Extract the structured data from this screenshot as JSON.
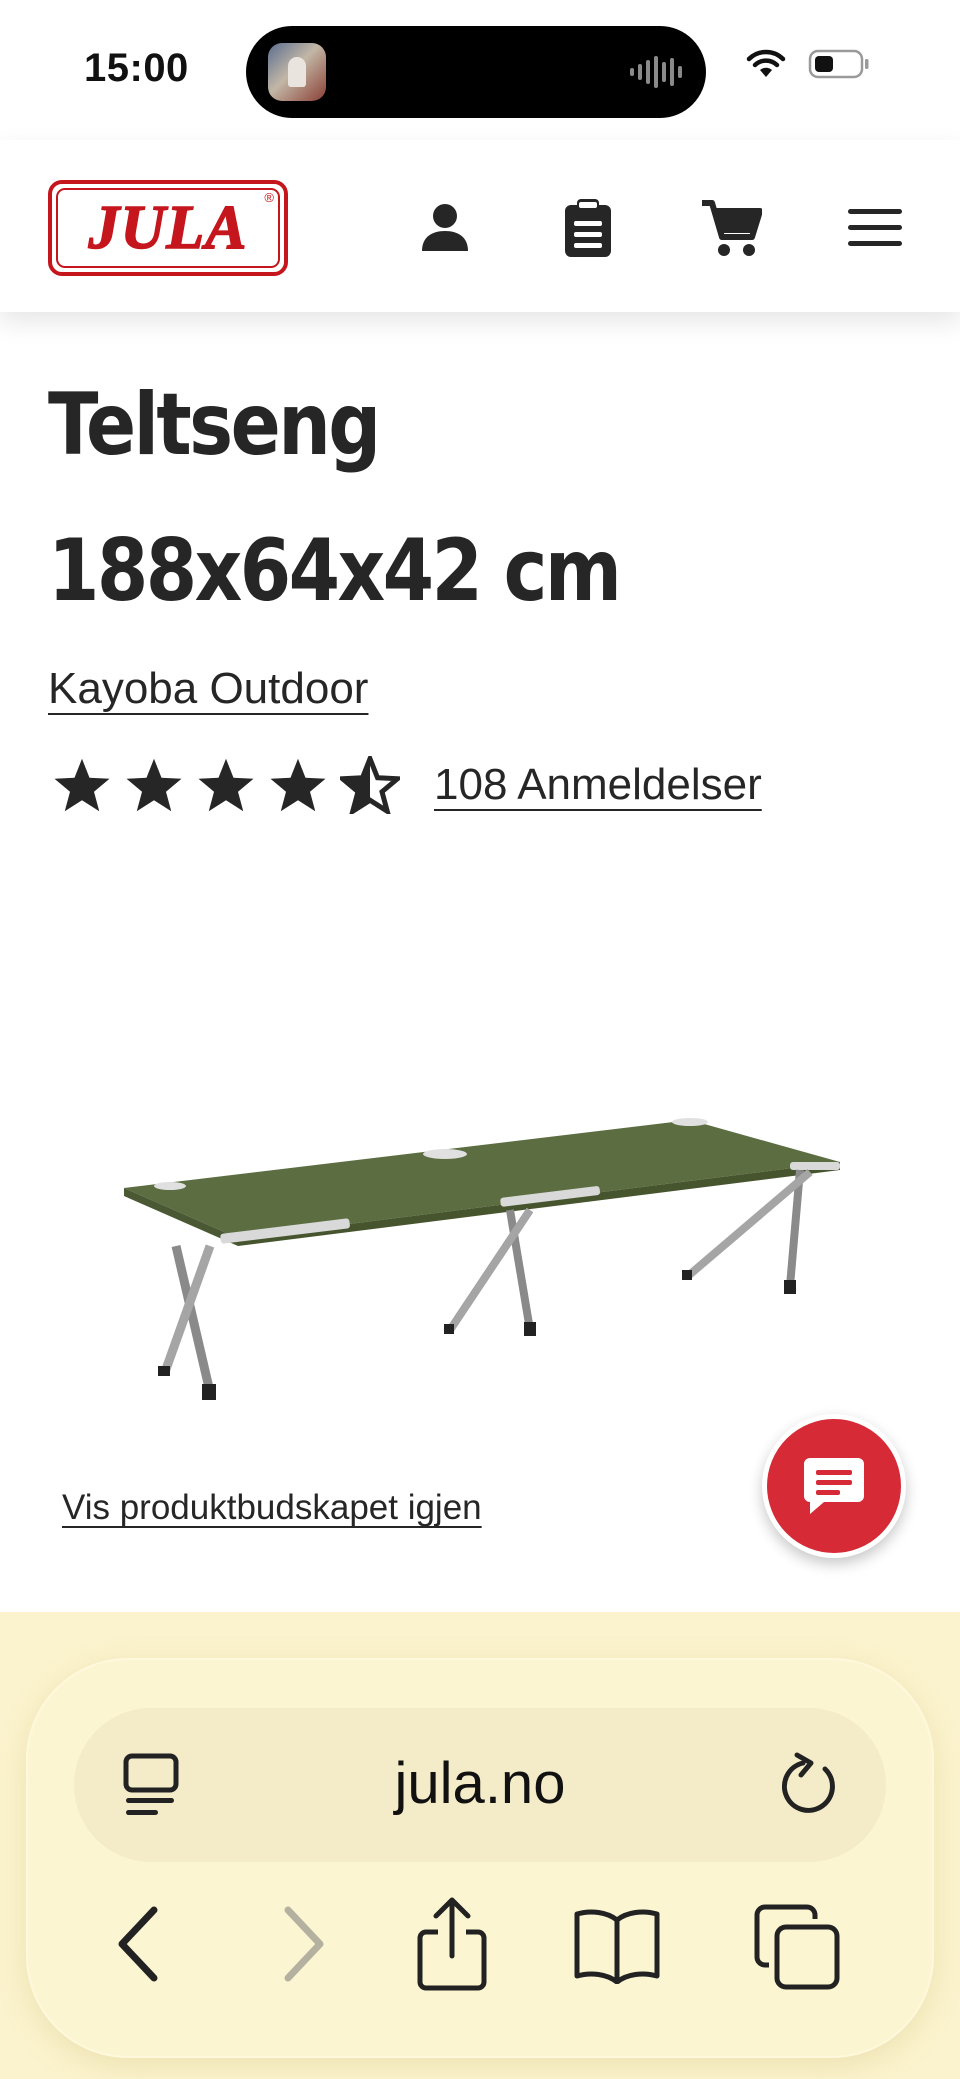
{
  "status_bar": {
    "time": "15:00"
  },
  "header": {
    "logo_text": "JULA",
    "logo_mark": "®",
    "icons": [
      "account-icon",
      "clipboard-list-icon",
      "cart-icon",
      "menu-icon"
    ]
  },
  "product": {
    "title": "Teltseng 188x64x42 cm",
    "brand": "Kayoba Outdoor",
    "rating": 4.5,
    "rating_max": 5,
    "reviews_label": "108 Anmeldelser",
    "show_message_link": "Vis produktbudskapet igjen"
  },
  "browser": {
    "url": "jula.no",
    "bottom_icons": [
      "back-icon",
      "forward-icon",
      "share-icon",
      "bookmarks-icon",
      "tabs-icon"
    ],
    "forward_enabled": false
  },
  "colors": {
    "brand_red": "#c4161c",
    "chat_red": "#d62a36",
    "text": "#262626",
    "cot_green": "#5c6e41",
    "safari_bar": "#fbf3cd"
  }
}
